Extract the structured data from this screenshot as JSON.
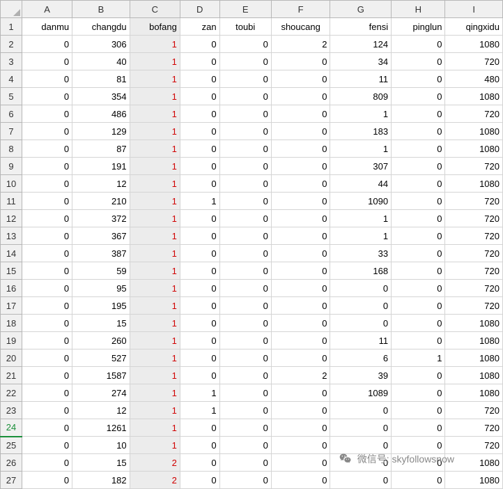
{
  "columns": [
    "A",
    "B",
    "C",
    "D",
    "E",
    "F",
    "G",
    "H",
    "I"
  ],
  "row_numbers": [
    1,
    2,
    3,
    4,
    5,
    6,
    7,
    8,
    9,
    10,
    11,
    12,
    13,
    14,
    15,
    16,
    17,
    18,
    19,
    20,
    21,
    22,
    23,
    24,
    25,
    26,
    27
  ],
  "selected_row_header": 24,
  "headers": {
    "A": "danmu",
    "B": "changdu",
    "C": "bofang",
    "D": "zan",
    "E": "toubi",
    "F": "shoucang",
    "G": "fensi",
    "H": "pinglun",
    "I": "qingxidu"
  },
  "rows": [
    {
      "A": 0,
      "B": 306,
      "C": 1,
      "D": 0,
      "E": 0,
      "F": 2,
      "G": 124,
      "H": 0,
      "I": 1080
    },
    {
      "A": 0,
      "B": 40,
      "C": 1,
      "D": 0,
      "E": 0,
      "F": 0,
      "G": 34,
      "H": 0,
      "I": 720
    },
    {
      "A": 0,
      "B": 81,
      "C": 1,
      "D": 0,
      "E": 0,
      "F": 0,
      "G": 11,
      "H": 0,
      "I": 480
    },
    {
      "A": 0,
      "B": 354,
      "C": 1,
      "D": 0,
      "E": 0,
      "F": 0,
      "G": 809,
      "H": 0,
      "I": 1080
    },
    {
      "A": 0,
      "B": 486,
      "C": 1,
      "D": 0,
      "E": 0,
      "F": 0,
      "G": 1,
      "H": 0,
      "I": 720
    },
    {
      "A": 0,
      "B": 129,
      "C": 1,
      "D": 0,
      "E": 0,
      "F": 0,
      "G": 183,
      "H": 0,
      "I": 1080
    },
    {
      "A": 0,
      "B": 87,
      "C": 1,
      "D": 0,
      "E": 0,
      "F": 0,
      "G": 1,
      "H": 0,
      "I": 1080
    },
    {
      "A": 0,
      "B": 191,
      "C": 1,
      "D": 0,
      "E": 0,
      "F": 0,
      "G": 307,
      "H": 0,
      "I": 720
    },
    {
      "A": 0,
      "B": 12,
      "C": 1,
      "D": 0,
      "E": 0,
      "F": 0,
      "G": 44,
      "H": 0,
      "I": 1080
    },
    {
      "A": 0,
      "B": 210,
      "C": 1,
      "D": 1,
      "E": 0,
      "F": 0,
      "G": 1090,
      "H": 0,
      "I": 720
    },
    {
      "A": 0,
      "B": 372,
      "C": 1,
      "D": 0,
      "E": 0,
      "F": 0,
      "G": 1,
      "H": 0,
      "I": 720
    },
    {
      "A": 0,
      "B": 367,
      "C": 1,
      "D": 0,
      "E": 0,
      "F": 0,
      "G": 1,
      "H": 0,
      "I": 720
    },
    {
      "A": 0,
      "B": 387,
      "C": 1,
      "D": 0,
      "E": 0,
      "F": 0,
      "G": 33,
      "H": 0,
      "I": 720
    },
    {
      "A": 0,
      "B": 59,
      "C": 1,
      "D": 0,
      "E": 0,
      "F": 0,
      "G": 168,
      "H": 0,
      "I": 720
    },
    {
      "A": 0,
      "B": 95,
      "C": 1,
      "D": 0,
      "E": 0,
      "F": 0,
      "G": 0,
      "H": 0,
      "I": 720
    },
    {
      "A": 0,
      "B": 195,
      "C": 1,
      "D": 0,
      "E": 0,
      "F": 0,
      "G": 0,
      "H": 0,
      "I": 720
    },
    {
      "A": 0,
      "B": 15,
      "C": 1,
      "D": 0,
      "E": 0,
      "F": 0,
      "G": 0,
      "H": 0,
      "I": 1080
    },
    {
      "A": 0,
      "B": 260,
      "C": 1,
      "D": 0,
      "E": 0,
      "F": 0,
      "G": 11,
      "H": 0,
      "I": 1080
    },
    {
      "A": 0,
      "B": 527,
      "C": 1,
      "D": 0,
      "E": 0,
      "F": 0,
      "G": 6,
      "H": 1,
      "I": 1080
    },
    {
      "A": 0,
      "B": 1587,
      "C": 1,
      "D": 0,
      "E": 0,
      "F": 2,
      "G": 39,
      "H": 0,
      "I": 1080
    },
    {
      "A": 0,
      "B": 274,
      "C": 1,
      "D": 1,
      "E": 0,
      "F": 0,
      "G": 1089,
      "H": 0,
      "I": 1080
    },
    {
      "A": 0,
      "B": 12,
      "C": 1,
      "D": 1,
      "E": 0,
      "F": 0,
      "G": 0,
      "H": 0,
      "I": 720
    },
    {
      "A": 0,
      "B": 1261,
      "C": 1,
      "D": 0,
      "E": 0,
      "F": 0,
      "G": 0,
      "H": 0,
      "I": 720
    },
    {
      "A": 0,
      "B": 10,
      "C": 1,
      "D": 0,
      "E": 0,
      "F": 0,
      "G": 0,
      "H": 0,
      "I": 720
    },
    {
      "A": 0,
      "B": 15,
      "C": 2,
      "D": 0,
      "E": 0,
      "F": 0,
      "G": 0,
      "H": 0,
      "I": 1080
    },
    {
      "A": 0,
      "B": 182,
      "C": 2,
      "D": 0,
      "E": 0,
      "F": 0,
      "G": 0,
      "H": 0,
      "I": 1080
    }
  ],
  "watermark": {
    "label": "微信号",
    "value": "skyfollowsnow"
  }
}
